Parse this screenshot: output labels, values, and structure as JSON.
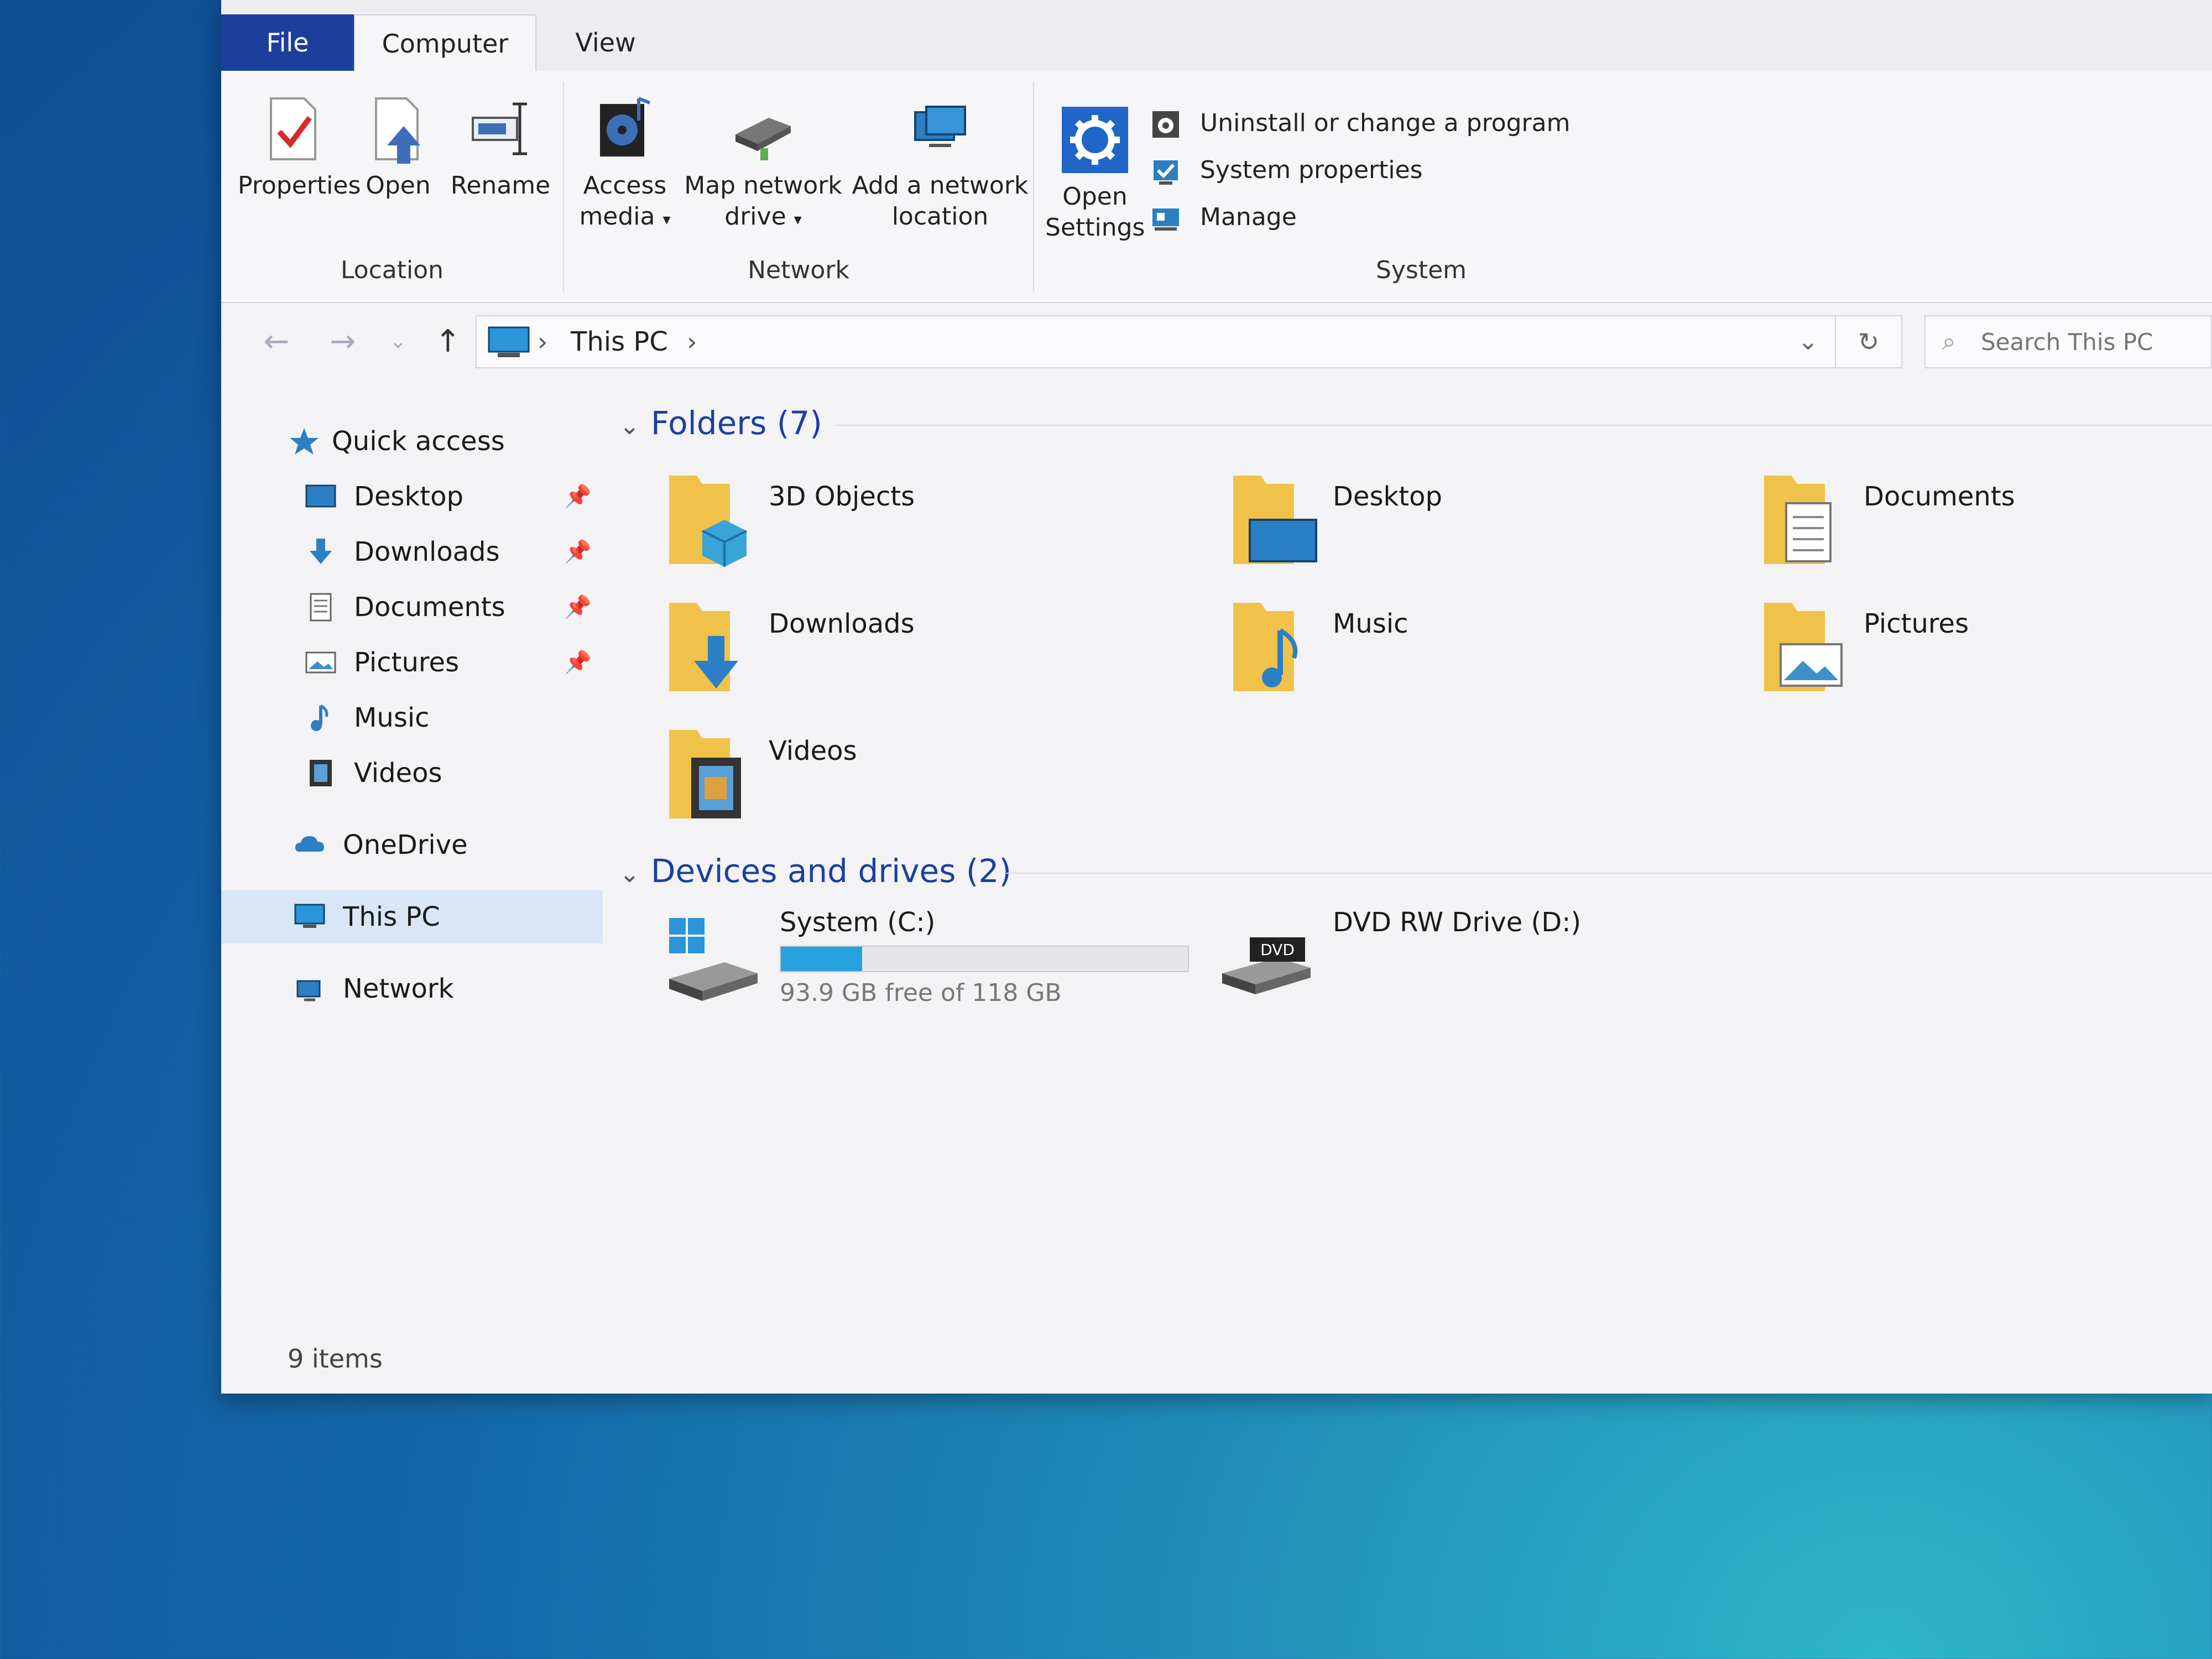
{
  "ribbon": {
    "tabs": [
      "File",
      "Computer",
      "View"
    ],
    "location": {
      "label": "Location",
      "buttons": [
        "Properties",
        "Open",
        "Rename"
      ]
    },
    "network": {
      "label": "Network",
      "access_media": "Access\nmedia",
      "map_drive": "Map network\ndrive",
      "add_location": "Add a network\nlocation"
    },
    "system": {
      "label": "System",
      "open_settings": "Open\nSettings",
      "uninstall": "Uninstall or change a program",
      "properties": "System properties",
      "manage": "Manage"
    }
  },
  "address": {
    "crumb": "This PC",
    "search_placeholder": "Search This PC"
  },
  "sidebar": {
    "quick_access": "Quick access",
    "items": [
      "Desktop",
      "Downloads",
      "Documents",
      "Pictures",
      "Music",
      "Videos"
    ],
    "onedrive": "OneDrive",
    "this_pc": "This PC",
    "network": "Network"
  },
  "folders_section": {
    "title": "Folders (7)",
    "items": [
      "3D Objects",
      "Desktop",
      "Documents",
      "Downloads",
      "Music",
      "Pictures",
      "Videos"
    ]
  },
  "drives_section": {
    "title": "Devices and drives (2)",
    "system_drive": {
      "name": "System (C:)",
      "free_text": "93.9 GB free of 118 GB",
      "used_fraction": 0.2
    },
    "dvd": {
      "name": "DVD RW Drive (D:)",
      "badge": "DVD"
    }
  },
  "status": {
    "items": "9 items"
  },
  "colors": {
    "accent": "#1c3f9e",
    "folder": "#f0c24a",
    "drive_bar": "#27a2db",
    "selection": "#d9e6f5"
  }
}
